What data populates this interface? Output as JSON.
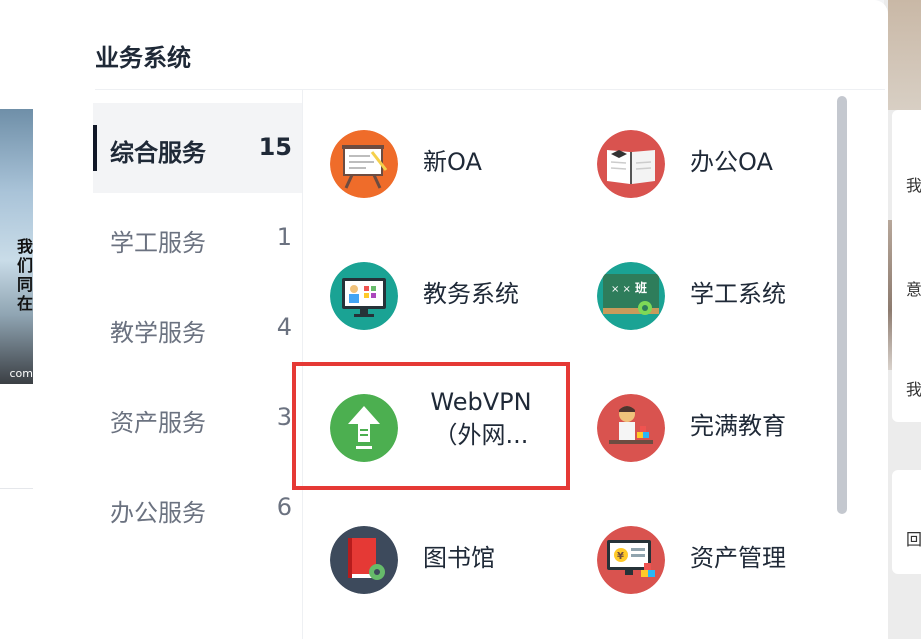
{
  "panel": {
    "title": "业务系统"
  },
  "categories": [
    {
      "label": "综合服务",
      "count": "15",
      "active": true
    },
    {
      "label": "学工服务",
      "count": "1",
      "active": false
    },
    {
      "label": "教学服务",
      "count": "4",
      "active": false
    },
    {
      "label": "资产服务",
      "count": "3",
      "active": false
    },
    {
      "label": "办公服务",
      "count": "6",
      "active": false
    }
  ],
  "apps": [
    {
      "name": "新OA",
      "icon": "presentation-board-icon",
      "color": "#ef6c2a"
    },
    {
      "name": "办公OA",
      "icon": "open-book-icon",
      "color": "#d9534f"
    },
    {
      "name": "教务系统",
      "icon": "teaching-monitor-icon",
      "color": "#1aa394"
    },
    {
      "name": "学工系统",
      "icon": "chalkboard-icon",
      "color": "#1aa394"
    },
    {
      "name": "WebVPN",
      "name_line2": "（外网...",
      "icon": "upload-arrow-icon",
      "color": "#4caf50"
    },
    {
      "name": "完满教育",
      "icon": "student-reading-icon",
      "color": "#d9534f"
    },
    {
      "name": "图书馆",
      "icon": "book-gear-icon",
      "color": "#3d4a5c"
    },
    {
      "name": "资产管理",
      "icon": "asset-monitor-icon",
      "color": "#d9534f"
    }
  ],
  "background": {
    "left_caption": "我\n们\n同\n在",
    "left_url": "com",
    "right_texts": [
      "我",
      "意",
      "我",
      "回"
    ]
  },
  "colors": {
    "highlight": "#e53935",
    "active_indicator": "#111827"
  }
}
